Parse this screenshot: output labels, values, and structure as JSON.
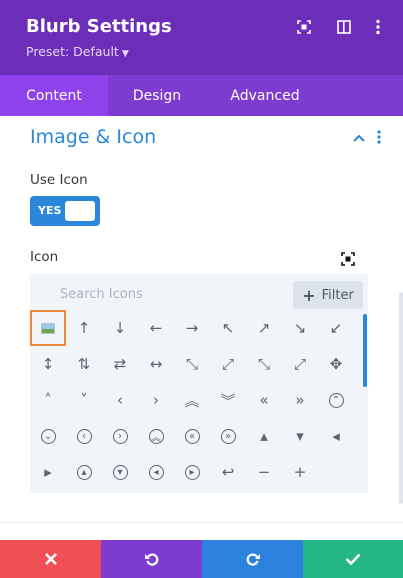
{
  "app": {
    "title": "Blurb Settings",
    "preset_label": "Preset: Default"
  },
  "tabs": [
    {
      "label": "Content"
    },
    {
      "label": "Design"
    },
    {
      "label": "Advanced"
    }
  ],
  "section": {
    "title": "Image & Icon"
  },
  "use_icon": {
    "label": "Use Icon",
    "toggle_text": "YES"
  },
  "icon_field": {
    "label": "Icon"
  },
  "picker": {
    "search_placeholder": "Search Icons",
    "filter_label": "Filter"
  },
  "colors": {
    "header": "#6c2eb9",
    "tab_active": "#8f42ec",
    "accent": "#2b87da",
    "cancel": "#ef4f55",
    "undo": "#7d3bcf",
    "redo": "#2e81df",
    "save": "#25b686"
  },
  "icons": [
    {
      "name": "image-icon",
      "glyph": ""
    },
    {
      "name": "arrow-up-icon",
      "glyph": "↑"
    },
    {
      "name": "arrow-down-icon",
      "glyph": "↓"
    },
    {
      "name": "arrow-left-icon",
      "glyph": "←"
    },
    {
      "name": "arrow-right-icon",
      "glyph": "→"
    },
    {
      "name": "arrow-up-left-icon",
      "glyph": "↖"
    },
    {
      "name": "arrow-up-right-icon",
      "glyph": "↗"
    },
    {
      "name": "arrow-down-right-icon",
      "glyph": "↘"
    },
    {
      "name": "arrow-down-left-icon",
      "glyph": "↙"
    },
    {
      "name": "arrow-up-down-icon",
      "glyph": "↕"
    },
    {
      "name": "arrows-vertical-icon",
      "glyph": "⇅"
    },
    {
      "name": "arrows-horizontal-icon",
      "glyph": "⇄"
    },
    {
      "name": "arrow-left-right-icon",
      "glyph": "↔"
    },
    {
      "name": "arrows-diagonal-icon",
      "glyph": "⤡"
    },
    {
      "name": "expand-diagonal-icon",
      "glyph": "⤢"
    },
    {
      "name": "contract-icon",
      "glyph": "⤡"
    },
    {
      "name": "expand-icon",
      "glyph": "⤢"
    },
    {
      "name": "move-icon",
      "glyph": "✥"
    },
    {
      "name": "chevron-up-icon",
      "glyph": "˄"
    },
    {
      "name": "chevron-down-icon",
      "glyph": "˅"
    },
    {
      "name": "chevron-left-icon",
      "glyph": "‹"
    },
    {
      "name": "chevron-right-icon",
      "glyph": "›"
    },
    {
      "name": "double-chevron-up-icon",
      "glyph": "︽"
    },
    {
      "name": "double-chevron-down-icon",
      "glyph": "︾"
    },
    {
      "name": "double-chevron-left-icon",
      "glyph": "«"
    },
    {
      "name": "double-chevron-right-icon",
      "glyph": "»"
    },
    {
      "name": "circle-chevron-up-icon",
      "glyph": "⌃"
    },
    {
      "name": "circle-chevron-down-icon",
      "glyph": "⌄"
    },
    {
      "name": "circle-chevron-left-icon",
      "glyph": "‹"
    },
    {
      "name": "circle-chevron-right-icon",
      "glyph": "›"
    },
    {
      "name": "circle-double-up-icon",
      "glyph": "︽"
    },
    {
      "name": "circle-double-left-icon",
      "glyph": "«"
    },
    {
      "name": "circle-double-right-icon",
      "glyph": "»"
    },
    {
      "name": "triangle-up-icon",
      "glyph": "▴"
    },
    {
      "name": "triangle-down-icon",
      "glyph": "▾"
    },
    {
      "name": "triangle-left-icon",
      "glyph": "◂"
    },
    {
      "name": "triangle-right-icon",
      "glyph": "▸"
    },
    {
      "name": "circle-triangle-up-icon",
      "glyph": "▴"
    },
    {
      "name": "circle-triangle-down-icon",
      "glyph": "▾"
    },
    {
      "name": "circle-triangle-left-icon",
      "glyph": "◂"
    },
    {
      "name": "circle-triangle-right-icon",
      "glyph": "▸"
    },
    {
      "name": "undo-arrow-icon",
      "glyph": "↩"
    },
    {
      "name": "minus-icon",
      "glyph": "−"
    },
    {
      "name": "plus-icon",
      "glyph": "+"
    }
  ]
}
